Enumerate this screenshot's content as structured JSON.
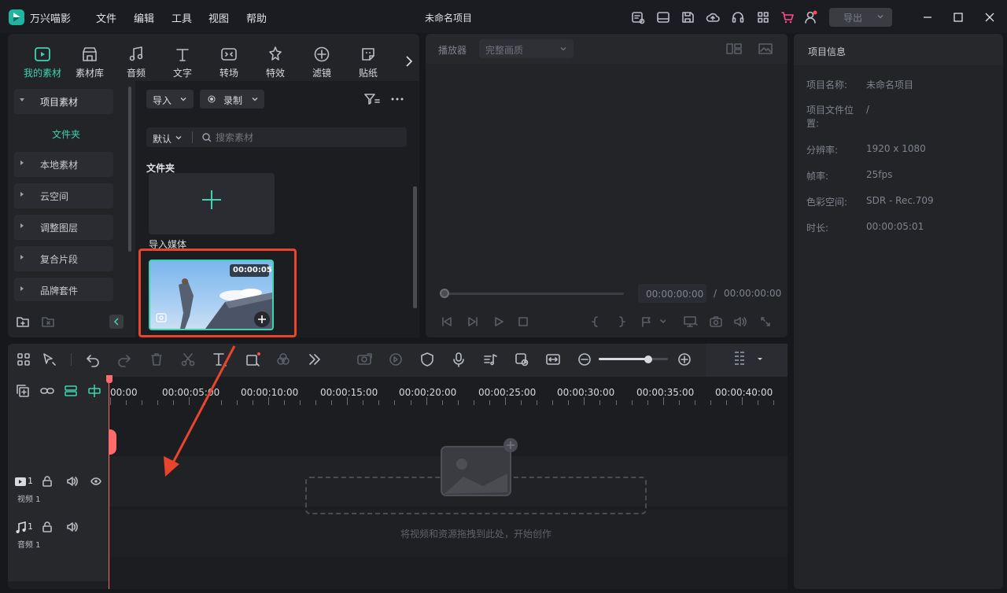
{
  "app": {
    "name": "万兴喵影",
    "project_title": "未命名项目",
    "export_label": "导出"
  },
  "menu": [
    "文件",
    "编辑",
    "工具",
    "视图",
    "帮助"
  ],
  "tabs": [
    "我的素材",
    "素材库",
    "音频",
    "文字",
    "转场",
    "特效",
    "滤镜",
    "贴纸"
  ],
  "sidebar": {
    "header": "项目素材",
    "folder": "文件夹",
    "items": [
      "本地素材",
      "云空间",
      "调整图层",
      "复合片段",
      "品牌套件"
    ]
  },
  "media": {
    "import_label": "导入",
    "record_label": "录制",
    "sort_label": "默认",
    "search_placeholder": "搜索素材",
    "section_title": "文件夹",
    "import_media_label": "导入媒体",
    "clip_duration": "00:00:05"
  },
  "player": {
    "label": "播放器",
    "quality": "完整画质",
    "current_time": "00:00:00:00",
    "separator": "/",
    "total_time": "00:00:00:00"
  },
  "info": {
    "title": "项目信息",
    "rows": [
      {
        "label": "项目名称:",
        "value": "未命名项目"
      },
      {
        "label": "项目文件位置:",
        "value": "/"
      },
      {
        "label": "分辨率:",
        "value": "1920 x 1080"
      },
      {
        "label": "帧率:",
        "value": "25fps"
      },
      {
        "label": "色彩空间:",
        "value": "SDR - Rec.709"
      },
      {
        "label": "时长:",
        "value": "00:00:05:01"
      }
    ]
  },
  "timeline": {
    "ruler": [
      "00:00",
      "00:00:05:00",
      "00:00:10:00",
      "00:00:15:00",
      "00:00:20:00",
      "00:00:25:00",
      "00:00:30:00",
      "00:00:35:00",
      "00:00:40:00"
    ],
    "video_track": {
      "num": "1",
      "label": "视频 1"
    },
    "audio_track": {
      "num": "1",
      "label": "音频 1"
    },
    "drop_hint": "将视频和资源拖拽到此处，开始创作",
    "zoom": 0.72
  },
  "colors": {
    "accent": "#3fd3b0",
    "highlight": "#e8452c",
    "playhead": "#ff6b6b"
  }
}
